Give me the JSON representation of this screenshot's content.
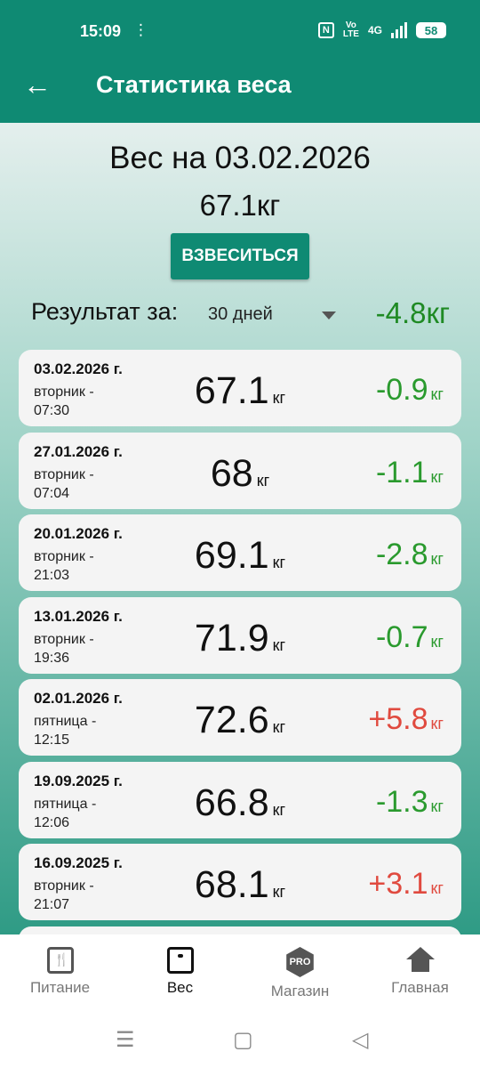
{
  "status": {
    "time": "15:09",
    "network": "4G",
    "battery": "58"
  },
  "header": {
    "title": "Статистика веса"
  },
  "summary": {
    "date_line": "Вес на 03.02.2026",
    "current_weight": "67.1кг",
    "weigh_button": "ВЗВЕСИТЬСЯ",
    "result_label": "Результат за:",
    "period": "30 дней",
    "result_total": "-4.8кг"
  },
  "entries": [
    {
      "date": "03.02.2026 г.",
      "day": "вторник -",
      "time": "07:30",
      "weight": "67.1",
      "unit": "кг",
      "delta": "-0.9",
      "trend": "down"
    },
    {
      "date": "27.01.2026 г.",
      "day": "вторник -",
      "time": "07:04",
      "weight": "68",
      "unit": "кг",
      "delta": "-1.1",
      "trend": "down"
    },
    {
      "date": "20.01.2026 г.",
      "day": "вторник -",
      "time": "21:03",
      "weight": "69.1",
      "unit": "кг",
      "delta": "-2.8",
      "trend": "down"
    },
    {
      "date": "13.01.2026 г.",
      "day": "вторник -",
      "time": "19:36",
      "weight": "71.9",
      "unit": "кг",
      "delta": "-0.7",
      "trend": "down"
    },
    {
      "date": "02.01.2026 г.",
      "day": "пятница -",
      "time": "12:15",
      "weight": "72.6",
      "unit": "кг",
      "delta": "+5.8",
      "trend": "up"
    },
    {
      "date": "19.09.2025 г.",
      "day": "пятница -",
      "time": "12:06",
      "weight": "66.8",
      "unit": "кг",
      "delta": "-1.3",
      "trend": "down"
    },
    {
      "date": "16.09.2025 г.",
      "day": "вторник -",
      "time": "21:07",
      "weight": "68.1",
      "unit": "кг",
      "delta": "+3.1",
      "trend": "up"
    }
  ],
  "nav": [
    {
      "label": "Питание",
      "icon": "food-icon",
      "active": false
    },
    {
      "label": "Вес",
      "icon": "scale-icon",
      "active": true
    },
    {
      "label": "Магазин",
      "icon": "pro-icon",
      "active": false
    },
    {
      "label": "Главная",
      "icon": "home-icon",
      "active": false
    }
  ],
  "nav_pro_badge": "PRO",
  "colors": {
    "primary": "#0f8a73",
    "loss": "#2a9a2e",
    "gain": "#e04a3f"
  }
}
